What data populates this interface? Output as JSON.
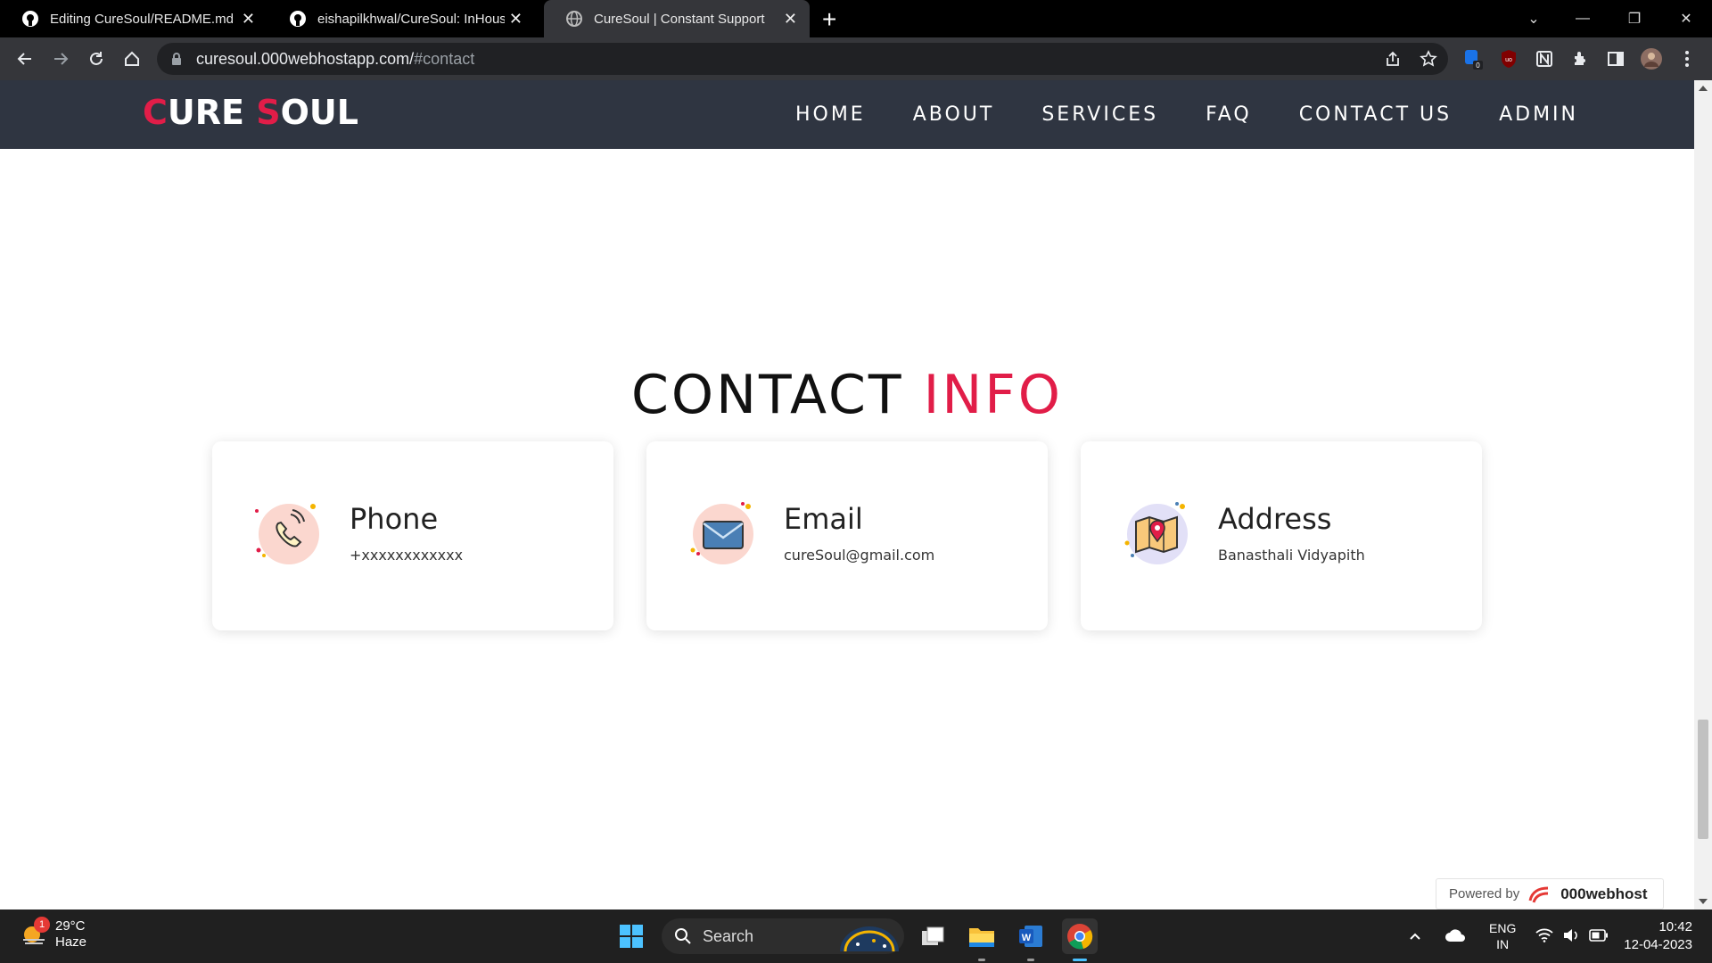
{
  "browser": {
    "tabs": [
      {
        "title": "Editing CureSoul/README.md at"
      },
      {
        "title": "eishapilkhwal/CureSoul: InHouse"
      },
      {
        "title": "CureSoul | Constant Support"
      }
    ],
    "address": {
      "host": "curesoul.000webhostapp.com/",
      "path": "#contact"
    },
    "extension_badge": "0"
  },
  "site": {
    "logo": {
      "c": "C",
      "ure": "URE ",
      "s": "S",
      "oul": "OUL"
    },
    "nav": [
      "HOME",
      "ABOUT",
      "SERVICES",
      "FAQ",
      "CONTACT US",
      "ADMIN"
    ],
    "heading": {
      "part1": "CONTACT ",
      "part2": "INFO"
    },
    "cards": [
      {
        "title": "Phone",
        "value": "+xxxxxxxxxxxx",
        "icon": "phone-icon"
      },
      {
        "title": "Email",
        "value": "cureSoul@gmail.com",
        "icon": "email-icon"
      },
      {
        "title": "Address",
        "value": "Banasthali Vidyapith",
        "icon": "map-pin-icon"
      }
    ],
    "powered": {
      "label": "Powered by",
      "brand": "000webhost"
    }
  },
  "taskbar": {
    "weather": {
      "temp": "29°C",
      "cond": "Haze",
      "badge": "1"
    },
    "search_label": "Search",
    "lang": {
      "line1": "ENG",
      "line2": "IN"
    },
    "clock": {
      "time": "10:42",
      "date": "12-04-2023"
    }
  },
  "colors": {
    "accent": "#e11d48",
    "navbar": "#2f3541"
  }
}
